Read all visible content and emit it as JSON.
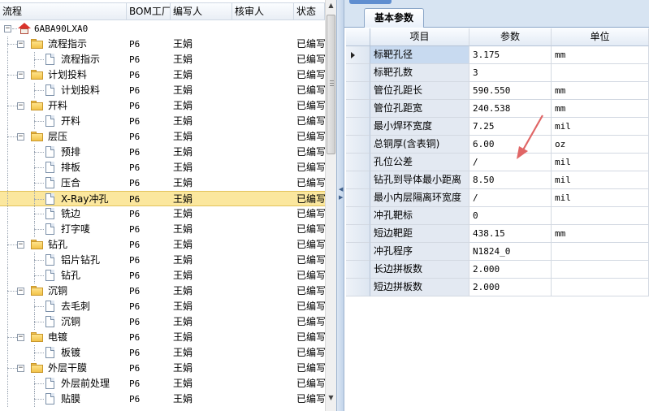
{
  "tree": {
    "columns": [
      "流程",
      "BOM工厂",
      "编写人",
      "核审人",
      "状态"
    ],
    "rows": [
      {
        "level": 0,
        "kind": "root",
        "label": "6ABA90LXA0",
        "factory": "",
        "writer": "",
        "reviewer": "",
        "status": ""
      },
      {
        "level": 1,
        "kind": "folder",
        "label": "流程指示",
        "factory": "P6",
        "writer": "王娟",
        "reviewer": "",
        "status": "已编写"
      },
      {
        "level": 2,
        "kind": "doc",
        "label": "流程指示",
        "factory": "P6",
        "writer": "王娟",
        "reviewer": "",
        "status": "已编写"
      },
      {
        "level": 1,
        "kind": "folder",
        "label": "计划投料",
        "factory": "P6",
        "writer": "王娟",
        "reviewer": "",
        "status": "已编写"
      },
      {
        "level": 2,
        "kind": "doc",
        "label": "计划投料",
        "factory": "P6",
        "writer": "王娟",
        "reviewer": "",
        "status": "已编写"
      },
      {
        "level": 1,
        "kind": "folder",
        "label": "开料",
        "factory": "P6",
        "writer": "王娟",
        "reviewer": "",
        "status": "已编写"
      },
      {
        "level": 2,
        "kind": "doc",
        "label": "开料",
        "factory": "P6",
        "writer": "王娟",
        "reviewer": "",
        "status": "已编写"
      },
      {
        "level": 1,
        "kind": "folder",
        "label": "层压",
        "factory": "P6",
        "writer": "王娟",
        "reviewer": "",
        "status": "已编写"
      },
      {
        "level": 2,
        "kind": "doc",
        "label": "预排",
        "factory": "P6",
        "writer": "王娟",
        "reviewer": "",
        "status": "已编写"
      },
      {
        "level": 2,
        "kind": "doc",
        "label": "排板",
        "factory": "P6",
        "writer": "王娟",
        "reviewer": "",
        "status": "已编写"
      },
      {
        "level": 2,
        "kind": "doc",
        "label": "压合",
        "factory": "P6",
        "writer": "王娟",
        "reviewer": "",
        "status": "已编写"
      },
      {
        "level": 2,
        "kind": "doc",
        "label": "X-Ray冲孔",
        "factory": "P6",
        "writer": "王娟",
        "reviewer": "",
        "status": "已编写",
        "selected": true
      },
      {
        "level": 2,
        "kind": "doc",
        "label": "铣边",
        "factory": "P6",
        "writer": "王娟",
        "reviewer": "",
        "status": "已编写"
      },
      {
        "level": 2,
        "kind": "doc",
        "label": "打字唛",
        "factory": "P6",
        "writer": "王娟",
        "reviewer": "",
        "status": "已编写"
      },
      {
        "level": 1,
        "kind": "folder",
        "label": "钻孔",
        "factory": "P6",
        "writer": "王娟",
        "reviewer": "",
        "status": "已编写"
      },
      {
        "level": 2,
        "kind": "doc",
        "label": "铝片钻孔",
        "factory": "P6",
        "writer": "王娟",
        "reviewer": "",
        "status": "已编写"
      },
      {
        "level": 2,
        "kind": "doc",
        "label": "钻孔",
        "factory": "P6",
        "writer": "王娟",
        "reviewer": "",
        "status": "已编写"
      },
      {
        "level": 1,
        "kind": "folder",
        "label": "沉铜",
        "factory": "P6",
        "writer": "王娟",
        "reviewer": "",
        "status": "已编写"
      },
      {
        "level": 2,
        "kind": "doc",
        "label": "去毛刺",
        "factory": "P6",
        "writer": "王娟",
        "reviewer": "",
        "status": "已编写"
      },
      {
        "level": 2,
        "kind": "doc",
        "label": "沉铜",
        "factory": "P6",
        "writer": "王娟",
        "reviewer": "",
        "status": "已编写"
      },
      {
        "level": 1,
        "kind": "folder",
        "label": "电镀",
        "factory": "P6",
        "writer": "王娟",
        "reviewer": "",
        "status": "已编写"
      },
      {
        "level": 2,
        "kind": "doc",
        "label": "板镀",
        "factory": "P6",
        "writer": "王娟",
        "reviewer": "",
        "status": "已编写"
      },
      {
        "level": 1,
        "kind": "folder",
        "label": "外层干膜",
        "factory": "P6",
        "writer": "王娟",
        "reviewer": "",
        "status": "已编写"
      },
      {
        "level": 2,
        "kind": "doc",
        "label": "外层前处理",
        "factory": "P6",
        "writer": "王娟",
        "reviewer": "",
        "status": "已编写"
      },
      {
        "level": 2,
        "kind": "doc",
        "label": "贴膜",
        "factory": "P6",
        "writer": "王娟",
        "reviewer": "",
        "status": "已编写"
      }
    ]
  },
  "params": {
    "tab_label": "基本参数",
    "columns": [
      "项目",
      "参数",
      "单位"
    ],
    "rows": [
      {
        "name": "标靶孔径",
        "value": "3.175",
        "unit": "mm",
        "current": true
      },
      {
        "name": "标靶孔数",
        "value": "3",
        "unit": ""
      },
      {
        "name": "管位孔距长",
        "value": "590.550",
        "unit": "mm"
      },
      {
        "name": "管位孔距宽",
        "value": "240.538",
        "unit": "mm"
      },
      {
        "name": "最小焊环宽度",
        "value": "7.25",
        "unit": "mil"
      },
      {
        "name": "总铜厚(含表铜)",
        "value": "6.00",
        "unit": "oz"
      },
      {
        "name": "孔位公差",
        "value": "/",
        "unit": "mil"
      },
      {
        "name": "钻孔到导体最小距离",
        "value": "8.50",
        "unit": "mil"
      },
      {
        "name": "最小内层隔离环宽度",
        "value": "/",
        "unit": "mil"
      },
      {
        "name": "冲孔靶标",
        "value": "0",
        "unit": ""
      },
      {
        "name": "短边靶距",
        "value": "438.15",
        "unit": "mm"
      },
      {
        "name": "冲孔程序",
        "value": "N1824_0",
        "unit": ""
      },
      {
        "name": "长边拼板数",
        "value": "2.000",
        "unit": ""
      },
      {
        "name": "短边拼板数",
        "value": "2.000",
        "unit": ""
      }
    ]
  },
  "colors": {
    "selected_row": "#fbe79e",
    "header_bg": "#e3ebf5",
    "tab_strip": "#d7e4f2",
    "annotation_arrow": "#e06666"
  },
  "icons": [
    "home-icon",
    "folder-icon",
    "document-icon",
    "expand-minus-icon",
    "row-pointer-icon",
    "scroll-up-icon",
    "scroll-down-icon",
    "splitter-collapse-icon"
  ]
}
